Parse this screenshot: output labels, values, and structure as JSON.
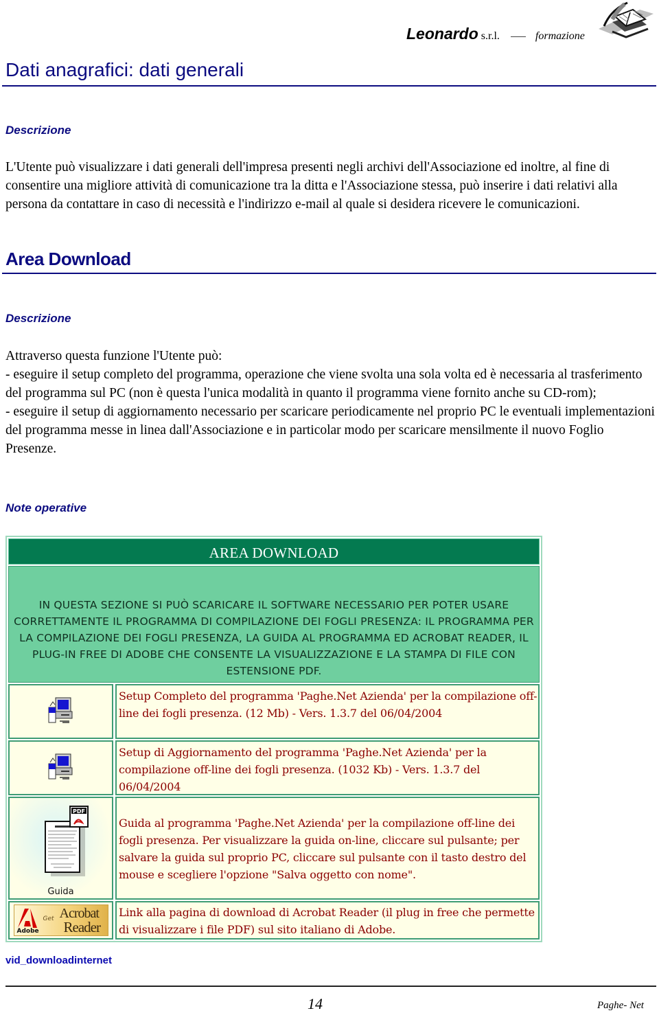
{
  "header": {
    "brand_name": "Leonardo",
    "brand_suffix": "s.r.l.",
    "brand_tagline": "formazione",
    "logo_icon": "book-quill-icon"
  },
  "section1": {
    "title": "Dati anagrafici: dati generali",
    "subheading": "Descrizione",
    "paragraph": "L'Utente può visualizzare i dati generali dell'impresa presenti negli archivi dell'Associazione ed inoltre, al fine di consentire una migliore attività di comunicazione tra la ditta e l'Associazione stessa, può inserire i dati relativi alla persona da contattare in caso di necessità e l'indirizzo e-mail al quale si desidera ricevere le comunicazioni."
  },
  "section2": {
    "title": "Area Download",
    "subheading": "Descrizione",
    "intro": "Attraverso questa funzione l'Utente può:",
    "bullets": [
      "- eseguire il setup completo del programma, operazione che viene svolta una sola volta ed è necessaria al trasferimento del programma sul PC (non è questa l'unica modalità in quanto il programma viene fornito anche su CD-rom);",
      "- eseguire il setup di aggiornamento necessario per scaricare periodicamente nel proprio PC le eventuali implementazioni del programma messe in linea dall'Associazione e in particolar modo per scaricare mensilmente il nuovo Foglio Presenze."
    ],
    "notes_heading": "Note operative"
  },
  "download_panel": {
    "title": "AREA DOWNLOAD",
    "intro": "IN QUESTA SEZIONE SI PUÒ SCARICARE IL SOFTWARE NECESSARIO PER POTER USARE CORRETTAMENTE IL PROGRAMMA DI COMPILAZIONE DEI FOGLI PRESENZA: IL PROGRAMMA PER LA COMPILAZIONE DEI FOGLI PRESENZA, LA GUIDA AL PROGRAMMA ED ACROBAT READER, IL PLUG-IN FREE DI ADOBE CHE CONSENTE LA VISUALIZZAZIONE E LA STAMPA DI FILE CON ESTENSIONE PDF.",
    "rows": [
      {
        "icon": "setup-computer-icon",
        "text": "Setup Completo del programma 'Paghe.Net Azienda' per la compilazione off-line dei fogli presenza. (12 Mb) - Vers. 1.3.7 del 06/04/2004"
      },
      {
        "icon": "setup-computer-icon",
        "text": "Setup di Aggiornamento del programma 'Paghe.Net Azienda' per la compilazione off-line dei fogli presenza. (1032 Kb) - Vers. 1.3.7 del 06/04/2004"
      },
      {
        "icon": "pdf-guide-icon",
        "icon_label": "Guida",
        "pdf_badge": "PDF",
        "text": "Guida al programma 'Paghe.Net Azienda' per la compilazione off-line dei fogli presenza. Per visualizzare la guida on-line, cliccare sul pulsante; per salvare la guida sul proprio PC, cliccare sul pulsante con il tasto destro del mouse e scegliere l'opzione \"Salva oggetto con nome\"."
      },
      {
        "icon": "get-acrobat-reader-icon",
        "badge": {
          "brand": "Adobe",
          "get": "Get",
          "line1": "Acrobat",
          "line2": "Reader"
        },
        "text": "Link alla pagina di download di Acrobat Reader (il plug in free che permette di visualizzare i file PDF) sul sito italiano di Adobe."
      }
    ]
  },
  "video_link": "vid_downloadinternet",
  "footer": {
    "page_number": "14",
    "product": "Paghe- Net"
  },
  "colors": {
    "heading_blue": "#0b0b80",
    "panel_dark_green": "#047a50",
    "panel_light_green": "#6fcf9f",
    "cell_cream": "#ffffe7",
    "cell_text_red": "#8b0000"
  }
}
